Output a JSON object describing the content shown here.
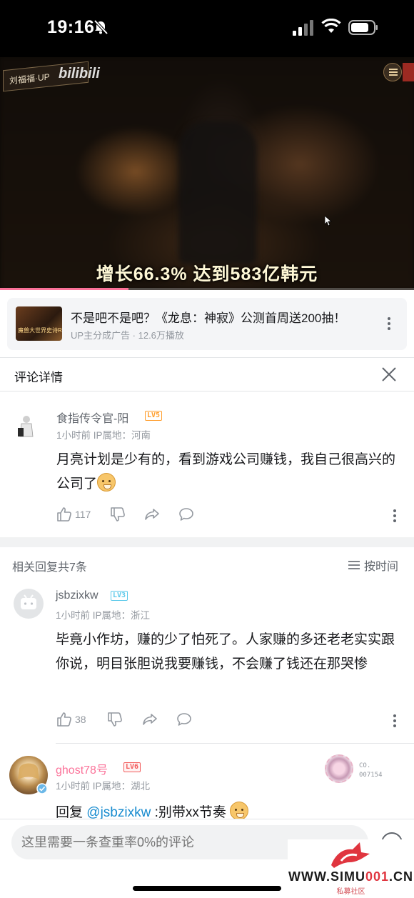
{
  "status_bar": {
    "time": "19:16"
  },
  "video": {
    "logo_text": "刘福福·UP",
    "brand": "bilibili",
    "subtitle": "增长66.3%  达到583亿韩元",
    "progress": 0.31
  },
  "ad": {
    "thumb_caption": "魔兽大世界史诗RPG",
    "title": "不是吧不是吧？《龙息：神寂》公测首周送200抽！",
    "meta": "UP主分成广告 · 12.6万播放"
  },
  "comment_header": {
    "title": "评论详情"
  },
  "main_comment": {
    "username": "食指传令官-阳",
    "level": "LV5",
    "meta": "1小时前  IP属地：河南",
    "text": "月亮计划是少有的，看到游戏公司赚钱，我自己很高兴的公司了",
    "likes": "117"
  },
  "replies_header": {
    "count": "相关回复共7条",
    "sort": "按时间"
  },
  "replies": [
    {
      "username": "jsbzixkw",
      "level": "LV3",
      "meta": "1小时前  IP属地：浙江",
      "text": "毕竟小作坊，赚的少了怕死了。人家赚的多还老老实实跟你说，明目张胆说我要赚钱，不会赚了钱还在那哭惨",
      "likes": "38"
    },
    {
      "username": "ghost78号",
      "level": "LV6",
      "meta": "1小时前  IP属地：湖北",
      "reply_prefix": "回复 ",
      "mention": "@jsbzixkw",
      "text": " :别带xx节奏",
      "badge_line1": "CO.",
      "badge_line2": "007154"
    }
  ],
  "input": {
    "placeholder": "这里需要一条查重率0%的评论"
  },
  "watermark": {
    "site_prefix": "WWW.SIMU",
    "site_accent": "001",
    "site_suffix": ".CN",
    "sub": "私募社区"
  },
  "colors": {
    "accent_pink": "#fb7299",
    "mention_blue": "#178bcf",
    "text_gray": "#9499a0"
  }
}
